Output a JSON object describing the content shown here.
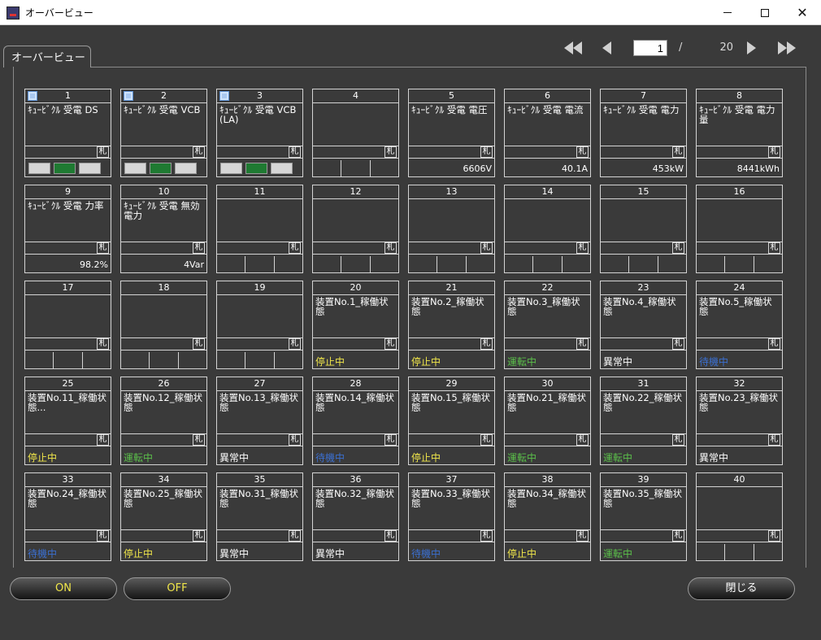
{
  "window": {
    "title": "オーバービュー",
    "icons": {
      "app": "app-icon",
      "minimize": "minimize-icon",
      "maximize": "maximize-icon",
      "close": "close-icon"
    },
    "close_glyph": "✕"
  },
  "tab": {
    "label": "オーバービュー"
  },
  "pager": {
    "current": "1",
    "separator": "/",
    "total": "20",
    "icons": [
      "first-page-icon",
      "prev-page-icon",
      "next-page-icon",
      "last-page-icon"
    ]
  },
  "fuda_label": "札",
  "colors": {
    "status_stop": "#f0e64a",
    "status_run": "#5bbf4a",
    "status_error_bg": "#f0e63a",
    "status_error_fg": "#d43333",
    "status_idle": "#3b6fd0"
  },
  "tiles": [
    {
      "num": "1",
      "name": "ｷｭｰﾋﾞｸﾙ 受電 DS",
      "checkbox": true,
      "kind": "buttons"
    },
    {
      "num": "2",
      "name": "ｷｭｰﾋﾞｸﾙ 受電 VCB",
      "checkbox": true,
      "kind": "buttons"
    },
    {
      "num": "3",
      "name": "ｷｭｰﾋﾞｸﾙ 受電 VCB(LA)",
      "checkbox": true,
      "kind": "buttons"
    },
    {
      "num": "4",
      "name": "",
      "kind": "cells"
    },
    {
      "num": "5",
      "name": "ｷｭｰﾋﾞｸﾙ 受電 電圧",
      "kind": "value",
      "value": "6606V"
    },
    {
      "num": "6",
      "name": "ｷｭｰﾋﾞｸﾙ 受電 電流",
      "kind": "value",
      "value": "40.1A"
    },
    {
      "num": "7",
      "name": "ｷｭｰﾋﾞｸﾙ 受電 電力",
      "kind": "value",
      "value": "453kW"
    },
    {
      "num": "8",
      "name": "ｷｭｰﾋﾞｸﾙ 受電 電力量",
      "kind": "value",
      "value": "8441kWh"
    },
    {
      "num": "9",
      "name": "ｷｭｰﾋﾞｸﾙ 受電 力率",
      "kind": "value",
      "value": "98.2%"
    },
    {
      "num": "10",
      "name": "ｷｭｰﾋﾞｸﾙ 受電 無効電力",
      "kind": "value",
      "value": "4Var"
    },
    {
      "num": "11",
      "name": "",
      "kind": "cells"
    },
    {
      "num": "12",
      "name": "",
      "kind": "cells"
    },
    {
      "num": "13",
      "name": "",
      "kind": "cells"
    },
    {
      "num": "14",
      "name": "",
      "kind": "cells"
    },
    {
      "num": "15",
      "name": "",
      "kind": "cells"
    },
    {
      "num": "16",
      "name": "",
      "kind": "cells"
    },
    {
      "num": "17",
      "name": "",
      "kind": "cells"
    },
    {
      "num": "18",
      "name": "",
      "kind": "cells"
    },
    {
      "num": "19",
      "name": "",
      "kind": "cells"
    },
    {
      "num": "20",
      "name": "装置No.1_稼働状態",
      "kind": "status",
      "status": "停止中",
      "state": "stop"
    },
    {
      "num": "21",
      "name": "装置No.2_稼働状態",
      "kind": "status",
      "status": "停止中",
      "state": "stop"
    },
    {
      "num": "22",
      "name": "装置No.3_稼働状態",
      "kind": "status",
      "status": "運転中",
      "state": "run"
    },
    {
      "num": "23",
      "name": "装置No.4_稼働状態",
      "kind": "status",
      "status": "異常中",
      "state": "error"
    },
    {
      "num": "24",
      "name": "装置No.5_稼働状態",
      "kind": "status",
      "status": "待機中",
      "state": "idle"
    },
    {
      "num": "25",
      "name": "装置No.11_稼働状態...",
      "kind": "status",
      "status": "停止中",
      "state": "stop"
    },
    {
      "num": "26",
      "name": "装置No.12_稼働状態",
      "kind": "status",
      "status": "運転中",
      "state": "run"
    },
    {
      "num": "27",
      "name": "装置No.13_稼働状態",
      "kind": "status",
      "status": "異常中",
      "state": "error"
    },
    {
      "num": "28",
      "name": "装置No.14_稼働状態",
      "kind": "status",
      "status": "待機中",
      "state": "idle"
    },
    {
      "num": "29",
      "name": "装置No.15_稼働状態",
      "kind": "status",
      "status": "停止中",
      "state": "stop"
    },
    {
      "num": "30",
      "name": "装置No.21_稼働状態",
      "kind": "status",
      "status": "運転中",
      "state": "run"
    },
    {
      "num": "31",
      "name": "装置No.22_稼働状態",
      "kind": "status",
      "status": "運転中",
      "state": "run"
    },
    {
      "num": "32",
      "name": "装置No.23_稼働状態",
      "kind": "status",
      "status": "異常中",
      "state": "error"
    },
    {
      "num": "33",
      "name": "装置No.24_稼働状態",
      "kind": "status",
      "status": "待機中",
      "state": "idle"
    },
    {
      "num": "34",
      "name": "装置No.25_稼働状態",
      "kind": "status",
      "status": "停止中",
      "state": "stop"
    },
    {
      "num": "35",
      "name": "装置No.31_稼働状態",
      "kind": "status",
      "status": "異常中",
      "state": "error"
    },
    {
      "num": "36",
      "name": "装置No.32_稼働状態",
      "kind": "status",
      "status": "異常中",
      "state": "error"
    },
    {
      "num": "37",
      "name": "装置No.33_稼働状態",
      "kind": "status",
      "status": "待機中",
      "state": "idle"
    },
    {
      "num": "38",
      "name": "装置No.34_稼働状態",
      "kind": "status",
      "status": "停止中",
      "state": "stop"
    },
    {
      "num": "39",
      "name": "装置No.35_稼働状態",
      "kind": "status",
      "status": "運転中",
      "state": "run"
    },
    {
      "num": "40",
      "name": "",
      "kind": "cells"
    }
  ],
  "buttons": {
    "on": "ON",
    "off": "OFF",
    "close": "閉じる"
  }
}
